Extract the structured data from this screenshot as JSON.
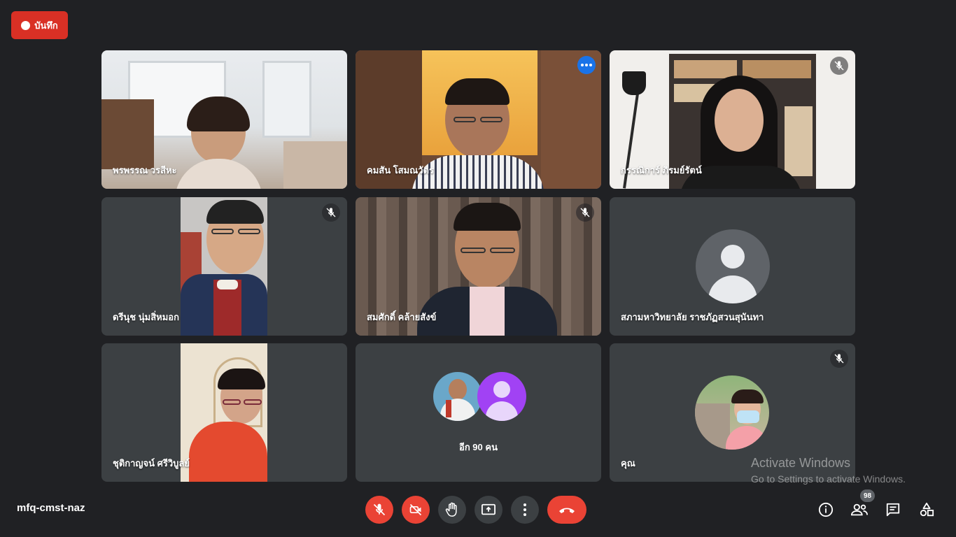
{
  "recording": {
    "label": "บันทึก",
    "color": "#d93025"
  },
  "tiles": [
    {
      "name": "พรพรรณ วรสีหะ",
      "muted": false
    },
    {
      "name": "คมสัน โสมณวัตร",
      "muted": false,
      "active": true
    },
    {
      "name": "กรรณิการ์ ภิรมย์รัตน์",
      "muted": true
    },
    {
      "name": "ดรีนุช นุ่มสิ่หมอก",
      "muted": true
    },
    {
      "name": "สมศักดิ์ คล้ายสังข์",
      "muted": true
    },
    {
      "name": "สภามหาวิทยาลัย ราชภัฏสวนสุนันทา",
      "muted": false
    },
    {
      "name": "ชุติกาญจน์ ศรีวิบูลย์",
      "muted": false
    },
    {
      "name": "",
      "more_label": "อีก 90 คน"
    },
    {
      "name": "คุณ",
      "muted": true
    }
  ],
  "watermark": {
    "line1": "Activate Windows",
    "line2": "Go to Settings to activate Windows."
  },
  "meeting_code": "mfq-cmst-naz",
  "controls": {
    "mic_icon": "mic-off-icon",
    "camera_icon": "camera-off-icon",
    "hand_icon": "raise-hand-icon",
    "present_icon": "present-screen-icon",
    "more_icon": "more-vert-icon",
    "end_icon": "end-call-icon"
  },
  "side_panel": {
    "participant_count": "98",
    "info_icon": "info-icon",
    "people_icon": "people-icon",
    "chat_icon": "chat-icon",
    "activities_icon": "activities-icon"
  },
  "colors": {
    "background": "#202124",
    "tile": "#3c4043",
    "accent": "#8ab4f8",
    "danger": "#ea4335"
  }
}
